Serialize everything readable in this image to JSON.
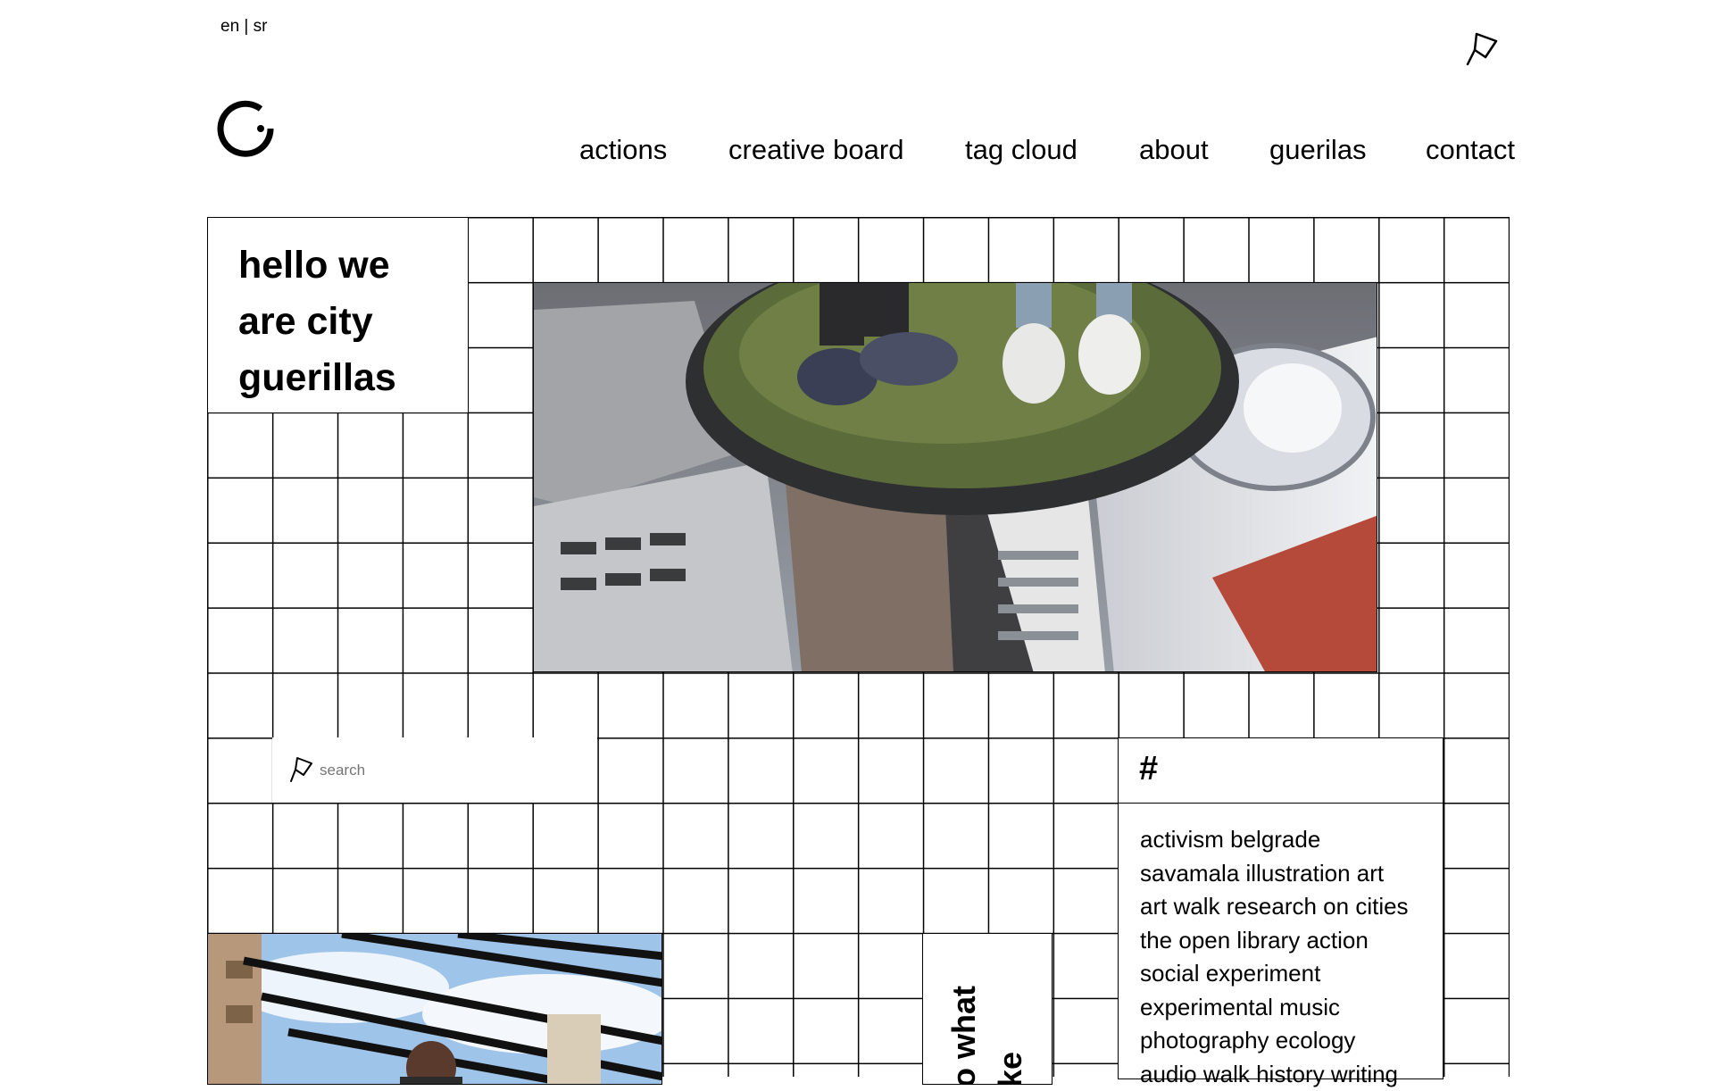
{
  "header": {
    "language_switch": "en | sr",
    "nav": [
      {
        "label": "actions"
      },
      {
        "label": "creative board"
      },
      {
        "label": "tag cloud"
      },
      {
        "label": "about"
      },
      {
        "label": "guerilas"
      },
      {
        "label": "contact"
      }
    ]
  },
  "intro": {
    "lines": [
      "hello we",
      "are city",
      "guerillas"
    ]
  },
  "search": {
    "placeholder": "search"
  },
  "tag_cloud": {
    "heading": "#",
    "tags": [
      "activism belgrade",
      "savamala illustration art",
      "art walk research on cities",
      "the open library action",
      "social experiment",
      "experimental music",
      "photography ecology",
      "audio walk history writing"
    ]
  },
  "vertical_text": {
    "lines": [
      "o what",
      "ke"
    ]
  },
  "colors": {
    "background": "#ffffff",
    "lines": "#000000",
    "placeholder": "#888888"
  }
}
